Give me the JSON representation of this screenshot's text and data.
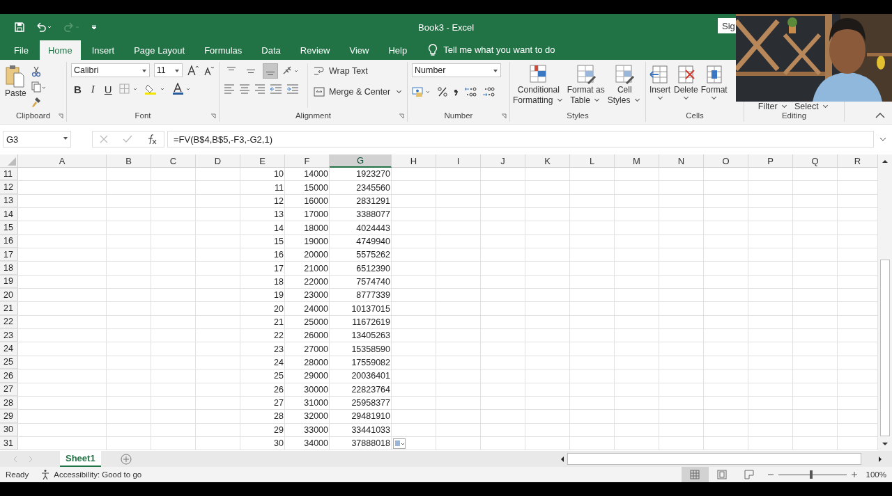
{
  "window": {
    "title": "Book3  -  Excel",
    "sign_in": "Sig"
  },
  "tabs": [
    {
      "label": "File",
      "selected": false
    },
    {
      "label": "Home",
      "selected": true
    },
    {
      "label": "Insert",
      "selected": false
    },
    {
      "label": "Page Layout",
      "selected": false
    },
    {
      "label": "Formulas",
      "selected": false
    },
    {
      "label": "Data",
      "selected": false
    },
    {
      "label": "Review",
      "selected": false
    },
    {
      "label": "View",
      "selected": false
    },
    {
      "label": "Help",
      "selected": false
    }
  ],
  "tell_me": "Tell me what you want to do",
  "clipboard": {
    "paste": "Paste",
    "label": "Clipboard"
  },
  "font": {
    "name": "Calibri",
    "size": "11",
    "bold": "B",
    "italic": "I",
    "underline": "U",
    "label": "Font"
  },
  "alignment": {
    "vertical": [
      {
        "selected": false
      },
      {
        "selected": false
      },
      {
        "selected": true
      }
    ],
    "wrap": "Wrap Text",
    "merge": "Merge & Center",
    "label": "Alignment"
  },
  "number": {
    "format": "Number",
    "label": "Number"
  },
  "styles": {
    "buttons": [
      [
        "Conditional",
        "Formatting"
      ],
      [
        "Format as",
        "Table"
      ],
      [
        "Cell",
        "Styles"
      ]
    ],
    "label": "Styles"
  },
  "cells": {
    "buttons": [
      "Insert",
      "Delete",
      "Format"
    ],
    "label": "Cells"
  },
  "editing": {
    "buttons": [
      "Filter",
      "Select"
    ],
    "label": "Editing"
  },
  "formula_bar": {
    "name_box": "G3",
    "formula": "=FV(B$4,B$5,-F3,-G2,1)"
  },
  "columns": [
    {
      "label": "A",
      "selected": false
    },
    {
      "label": "B",
      "selected": false
    },
    {
      "label": "C",
      "selected": false
    },
    {
      "label": "D",
      "selected": false
    },
    {
      "label": "E",
      "selected": false
    },
    {
      "label": "F",
      "selected": false
    },
    {
      "label": "G",
      "selected": true
    },
    {
      "label": "H",
      "selected": false
    },
    {
      "label": "I",
      "selected": false
    },
    {
      "label": "J",
      "selected": false
    },
    {
      "label": "K",
      "selected": false
    },
    {
      "label": "L",
      "selected": false
    },
    {
      "label": "M",
      "selected": false
    },
    {
      "label": "N",
      "selected": false
    },
    {
      "label": "O",
      "selected": false
    },
    {
      "label": "P",
      "selected": false
    },
    {
      "label": "Q",
      "selected": false
    },
    {
      "label": "R",
      "selected": false
    }
  ],
  "rows": [
    {
      "number": "11",
      "values": [
        "10",
        "14000",
        "1923270"
      ]
    },
    {
      "number": "12",
      "values": [
        "11",
        "15000",
        "2345560"
      ]
    },
    {
      "number": "13",
      "values": [
        "12",
        "16000",
        "2831291"
      ]
    },
    {
      "number": "14",
      "values": [
        "13",
        "17000",
        "3388077"
      ]
    },
    {
      "number": "15",
      "values": [
        "14",
        "18000",
        "4024443"
      ]
    },
    {
      "number": "16",
      "values": [
        "15",
        "19000",
        "4749940"
      ]
    },
    {
      "number": "17",
      "values": [
        "16",
        "20000",
        "5575262"
      ]
    },
    {
      "number": "18",
      "values": [
        "17",
        "21000",
        "6512390"
      ]
    },
    {
      "number": "19",
      "values": [
        "18",
        "22000",
        "7574740"
      ]
    },
    {
      "number": "20",
      "values": [
        "19",
        "23000",
        "8777339"
      ]
    },
    {
      "number": "21",
      "values": [
        "20",
        "24000",
        "10137015"
      ]
    },
    {
      "number": "22",
      "values": [
        "21",
        "25000",
        "11672619"
      ]
    },
    {
      "number": "23",
      "values": [
        "22",
        "26000",
        "13405263"
      ]
    },
    {
      "number": "24",
      "values": [
        "23",
        "27000",
        "15358590"
      ]
    },
    {
      "number": "25",
      "values": [
        "24",
        "28000",
        "17559082"
      ]
    },
    {
      "number": "26",
      "values": [
        "25",
        "29000",
        "20036401"
      ]
    },
    {
      "number": "27",
      "values": [
        "26",
        "30000",
        "22823764"
      ]
    },
    {
      "number": "28",
      "values": [
        "27",
        "31000",
        "25958377"
      ]
    },
    {
      "number": "29",
      "values": [
        "28",
        "32000",
        "29481910"
      ]
    },
    {
      "number": "30",
      "values": [
        "29",
        "33000",
        "33441033"
      ]
    },
    {
      "number": "31",
      "values": [
        "30",
        "34000",
        "37888018"
      ]
    }
  ],
  "sheet_tabs": [
    {
      "label": "Sheet1",
      "selected": true
    }
  ],
  "status": {
    "ready": "Ready",
    "accessibility": "Accessibility: Good to go",
    "views": [
      {
        "selected": true
      },
      {
        "selected": false
      },
      {
        "selected": false
      }
    ],
    "zoom": {
      "level": 0.48
    },
    "zoom_text": "100%"
  }
}
